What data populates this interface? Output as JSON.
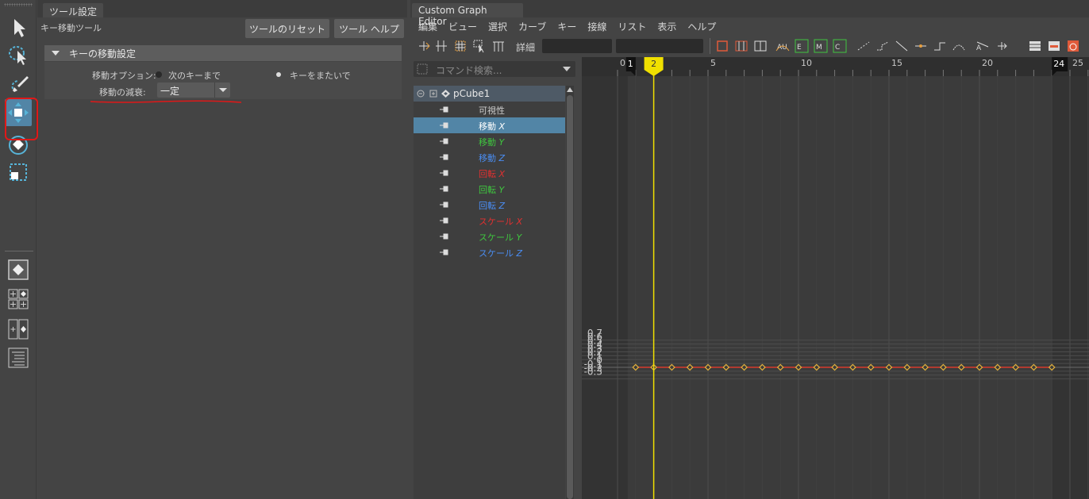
{
  "toolbox": {
    "tools": [
      "select-tool",
      "lasso-tool",
      "paint-tool",
      "move-key-tool",
      "region-tool",
      "scale-tool"
    ],
    "active_tool": "move-key-tool"
  },
  "tool_settings": {
    "tab_label": "ツール設定",
    "tool_name": "キー移動ツール",
    "reset_button": "ツールのリセット",
    "help_button": "ツール ヘルプ",
    "section_title": "キーの移動設定",
    "move_option_label": "移動オプション:",
    "option_next_key": "次のキーまで",
    "option_over_keys": "キーをまたいで",
    "falloff_label": "移動の減衰:",
    "falloff_value": "一定"
  },
  "graph_editor": {
    "tab_label": "Custom Graph Editor",
    "menus": [
      "編集",
      "ビュー",
      "選択",
      "カーブ",
      "キー",
      "接線",
      "リスト",
      "表示",
      "ヘルプ"
    ],
    "toolbar_detail_label": "詳細",
    "search_placeholder": "コマンド検索...",
    "node_name": "pCube1",
    "attributes": [
      {
        "base": "可視性",
        "axis": "",
        "color": "#cccccc",
        "selected": false
      },
      {
        "base": "移動",
        "axis": "X",
        "color": "#ffffff",
        "selected": true
      },
      {
        "base": "移動",
        "axis": "Y",
        "color": "#3fc53f",
        "selected": false
      },
      {
        "base": "移動",
        "axis": "Z",
        "color": "#4a8cf0",
        "selected": false
      },
      {
        "base": "回転",
        "axis": "X",
        "color": "#e03030",
        "selected": false
      },
      {
        "base": "回転",
        "axis": "Y",
        "color": "#3fc53f",
        "selected": false
      },
      {
        "base": "回転",
        "axis": "Z",
        "color": "#4a8cf0",
        "selected": false
      },
      {
        "base": "スケール",
        "axis": "X",
        "color": "#e03030",
        "selected": false
      },
      {
        "base": "スケール",
        "axis": "Y",
        "color": "#3fc53f",
        "selected": false
      },
      {
        "base": "スケール",
        "axis": "Z",
        "color": "#4a8cf0",
        "selected": false
      }
    ],
    "ruler": {
      "start_frame": "1",
      "current_frame": "2",
      "end_frame": "24",
      "tick_labels": [
        "0",
        "5",
        "10",
        "15",
        "20",
        "25"
      ]
    },
    "y_labels": [
      "0.7",
      "0.6",
      "0.5",
      "0.4",
      "0.3",
      "0.2",
      "0.1",
      "0",
      "-0.1",
      "-0.2",
      "-0.3"
    ],
    "curve": {
      "color": "#d83a2c",
      "key_color": "#e8b43c",
      "key_frames": [
        1,
        2,
        3,
        4,
        5,
        6,
        7,
        8,
        9,
        10,
        11,
        12,
        13,
        14,
        15,
        16,
        17,
        18,
        19,
        20,
        21,
        22,
        23,
        24
      ],
      "value": 0
    },
    "current_frame_color": "#f0e000"
  }
}
